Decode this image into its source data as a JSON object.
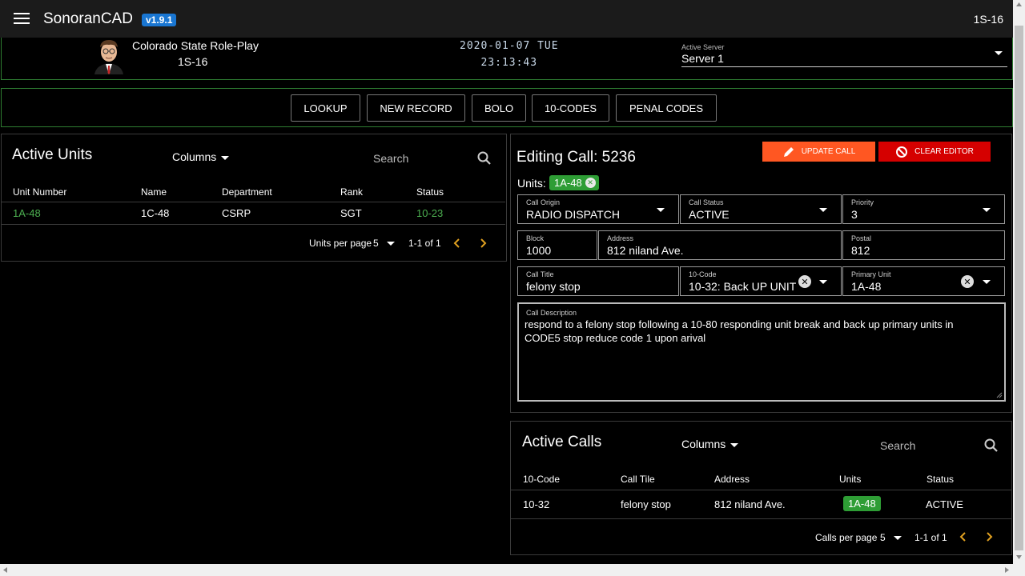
{
  "app": {
    "title": "SonoranCAD",
    "version": "v1.9.1",
    "unit_id": "1S-16"
  },
  "header": {
    "community": "Colorado State Role-Play",
    "callsign": "1S-16",
    "date": "2020-01-07 TUE",
    "time": "23:13:43",
    "server_label": "Active Server",
    "server_value": "Server 1"
  },
  "toolbar": {
    "buttons": [
      "LOOKUP",
      "NEW RECORD",
      "BOLO",
      "10-CODES",
      "PENAL CODES"
    ]
  },
  "active_units": {
    "title": "Active Units",
    "columns_label": "Columns",
    "search_placeholder": "Search",
    "headers": [
      "Unit Number",
      "Name",
      "Department",
      "Rank",
      "Status"
    ],
    "rows": [
      {
        "unit_number": "1A-48",
        "name": "1C-48",
        "department": "CSRP",
        "rank": "SGT",
        "status": "10-23"
      }
    ],
    "per_page_label": "Units per page",
    "per_page_value": "5",
    "range": "1-1 of 1"
  },
  "editor": {
    "title": "Editing Call: 5236",
    "update_label": "UPDATE CALL",
    "clear_label": "CLEAR EDITOR",
    "units_label": "Units:",
    "units": [
      "1A-48"
    ],
    "fields": {
      "call_origin": {
        "label": "Call Origin",
        "value": "RADIO DISPATCH"
      },
      "call_status": {
        "label": "Call Status",
        "value": "ACTIVE"
      },
      "priority": {
        "label": "Priority",
        "value": "3"
      },
      "block": {
        "label": "Block",
        "value": "1000"
      },
      "address": {
        "label": "Address",
        "value": "812 niland Ave."
      },
      "postal": {
        "label": "Postal",
        "value": "812"
      },
      "call_title": {
        "label": "Call Title",
        "value": "felony stop"
      },
      "ten_code": {
        "label": "10-Code",
        "value": "10-32: Back UP UNIT"
      },
      "primary_unit": {
        "label": "Primary Unit",
        "value": "1A-48"
      }
    },
    "description": {
      "label": "Call Description",
      "value": "respond to a felony stop following a 10-80 responding unit break and back up primary units in CODE5 stop reduce code 1 upon arival"
    }
  },
  "active_calls": {
    "title": "Active Calls",
    "columns_label": "Columns",
    "search_placeholder": "Search",
    "headers": [
      "10-Code",
      "Call Tile",
      "Address",
      "Units",
      "Status"
    ],
    "rows": [
      {
        "code": "10-32",
        "title": "felony stop",
        "address": "812 niland Ave.",
        "units": "1A-48",
        "status": "ACTIVE"
      }
    ],
    "per_page_label": "Calls per page",
    "per_page_value": "5",
    "range": "1-1 of 1"
  },
  "colors": {
    "accent_green": "#2e9d35",
    "update_orange": "#ff5722",
    "clear_red": "#d50000",
    "pager_orange": "#e0a020",
    "version_blue": "#1976d2"
  }
}
